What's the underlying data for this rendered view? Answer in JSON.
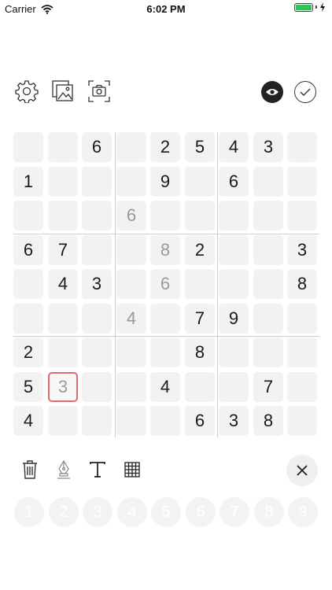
{
  "status_bar": {
    "carrier": "Carrier",
    "time": "6:02 PM"
  },
  "toolbar": {
    "icons": [
      "gear-icon",
      "photos-icon",
      "camera-scan-icon",
      "eye-icon",
      "check-icon"
    ]
  },
  "board": {
    "rows": [
      [
        "",
        "",
        "6",
        "",
        "2",
        "5",
        "4",
        "3",
        ""
      ],
      [
        "1",
        "",
        "",
        "",
        "9",
        "",
        "6",
        "",
        ""
      ],
      [
        "",
        "",
        "",
        "6",
        "",
        "",
        "",
        "",
        ""
      ],
      [
        "6",
        "7",
        "",
        "",
        "8",
        "2",
        "",
        "",
        "3"
      ],
      [
        "",
        "4",
        "3",
        "",
        "6",
        "",
        "",
        "",
        "8"
      ],
      [
        "",
        "",
        "",
        "4",
        "",
        "7",
        "9",
        "",
        ""
      ],
      [
        "2",
        "",
        "",
        "",
        "",
        "8",
        "",
        "",
        ""
      ],
      [
        "5",
        "3",
        "",
        "",
        "4",
        "",
        "",
        "7",
        ""
      ],
      [
        "4",
        "",
        "",
        "",
        "",
        "6",
        "3",
        "8",
        ""
      ]
    ],
    "pencil_cells": [
      [
        2,
        3
      ],
      [
        3,
        4
      ],
      [
        4,
        4
      ],
      [
        5,
        3
      ],
      [
        7,
        1
      ]
    ],
    "selected_cell": [
      7,
      1
    ],
    "selected_color": "#e06b6b"
  },
  "tools": {
    "icons": [
      "trash-icon",
      "pen-nib-icon",
      "text-icon",
      "grid-icon",
      "close-icon"
    ]
  },
  "numpad": {
    "keys": [
      "1",
      "2",
      "3",
      "4",
      "5",
      "6",
      "7",
      "8",
      "9"
    ]
  }
}
